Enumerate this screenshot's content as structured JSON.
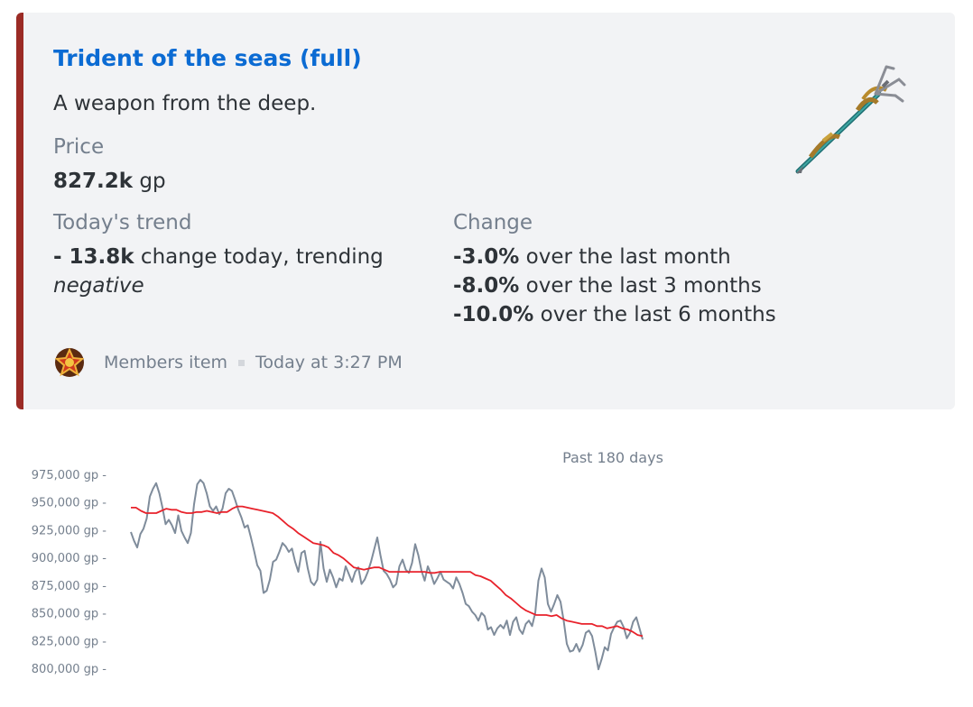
{
  "embed": {
    "accent_color": "#9b2b25",
    "title": "Trident of the seas (full)",
    "description": "A weapon from the deep.",
    "price": {
      "label": "Price",
      "value": "827.2k",
      "unit": " gp"
    },
    "trend": {
      "label": "Today's trend",
      "value": "- 13.8k",
      "text": " change today, trending",
      "direction": "negative"
    },
    "change": {
      "label": "Change",
      "rows": [
        {
          "value": "-3.0%",
          "text": " over the last month"
        },
        {
          "value": "-8.0%",
          "text": " over the last 3 months"
        },
        {
          "value": "-10.0%",
          "text": " over the last 6 months"
        }
      ]
    },
    "thumbnail_icon": "trident-icon",
    "footer": {
      "icon": "members-star-icon",
      "text": "Members item",
      "timestamp": "Today at 3:27 PM"
    }
  },
  "chart_data": {
    "type": "line",
    "title": "Past 180 days",
    "xlabel": "",
    "ylabel": "",
    "ylim": [
      795000,
      980000
    ],
    "yticks": [
      975000,
      950000,
      925000,
      900000,
      875000,
      850000,
      825000,
      800000
    ],
    "ytick_labels": [
      "975,000 gp -",
      "950,000 gp -",
      "925,000 gp -",
      "900,000 gp -",
      "875,000 gp -",
      "850,000 gp -",
      "825,000 gp -",
      "800,000 gp -"
    ],
    "series": [
      {
        "color": "#7f8c9b",
        "values": [
          923000,
          915000,
          909000,
          921000,
          926000,
          935000,
          955000,
          962000,
          967000,
          958000,
          945000,
          930000,
          934000,
          929000,
          922000,
          938000,
          924000,
          918000,
          913000,
          922000,
          948000,
          966000,
          970000,
          967000,
          958000,
          946000,
          942000,
          946000,
          939000,
          944000,
          958000,
          962000,
          960000,
          952000,
          943000,
          936000,
          927000,
          929000,
          918000,
          906000,
          893000,
          888000,
          868000,
          870000,
          880000,
          896000,
          898000,
          905000,
          913000,
          910000,
          905000,
          908000,
          896000,
          887000,
          904000,
          906000,
          890000,
          878000,
          875000,
          880000,
          914000,
          890000,
          878000,
          889000,
          882000,
          873000,
          881000,
          879000,
          892000,
          885000,
          878000,
          887000,
          891000,
          876000,
          880000,
          887000,
          896000,
          907000,
          918000,
          902000,
          888000,
          885000,
          880000,
          873000,
          876000,
          892000,
          898000,
          889000,
          886000,
          895000,
          912000,
          902000,
          888000,
          879000,
          892000,
          885000,
          876000,
          881000,
          887000,
          880000,
          878000,
          876000,
          872000,
          882000,
          876000,
          868000,
          858000,
          856000,
          851000,
          848000,
          843000,
          850000,
          847000,
          835000,
          837000,
          830000,
          836000,
          839000,
          836000,
          843000,
          830000,
          842000,
          846000,
          835000,
          831000,
          840000,
          843000,
          838000,
          850000,
          879000,
          890000,
          882000,
          858000,
          851000,
          858000,
          866000,
          860000,
          843000,
          822000,
          815000,
          816000,
          822000,
          815000,
          821000,
          832000,
          834000,
          829000,
          815000,
          799000,
          808000,
          819000,
          816000,
          831000,
          837000,
          842000,
          843000,
          837000,
          827000,
          832000,
          842000,
          846000,
          836000,
          826000
        ]
      },
      {
        "color": "#e8222b",
        "values": [
          945000,
          945000,
          942000,
          940000,
          940000,
          940000,
          942000,
          944000,
          943000,
          943000,
          941000,
          940000,
          940000,
          941000,
          941000,
          942000,
          941000,
          940000,
          941000,
          941000,
          944000,
          946000,
          946000,
          945000,
          944000,
          943000,
          942000,
          941000,
          940000,
          937000,
          933000,
          929000,
          926000,
          922000,
          919000,
          916000,
          913000,
          912000,
          911000,
          909000,
          904000,
          902000,
          899000,
          895000,
          891000,
          890000,
          889000,
          890000,
          891000,
          891000,
          889000,
          887000,
          887000,
          887000,
          887000,
          887000,
          887000,
          887000,
          887000,
          886000,
          886000,
          887000,
          887000,
          887000,
          887000,
          887000,
          887000,
          887000,
          884000,
          883000,
          881000,
          879000,
          875000,
          871000,
          866000,
          863000,
          859000,
          855000,
          852000,
          850000,
          848000,
          848000,
          848000,
          847000,
          848000,
          845000,
          843000,
          842000,
          841000,
          840000,
          840000,
          840000,
          838000,
          838000,
          836000,
          837000,
          838000,
          836000,
          835000,
          833000,
          830000,
          829000
        ]
      }
    ],
    "grid": false,
    "legend": "none"
  }
}
